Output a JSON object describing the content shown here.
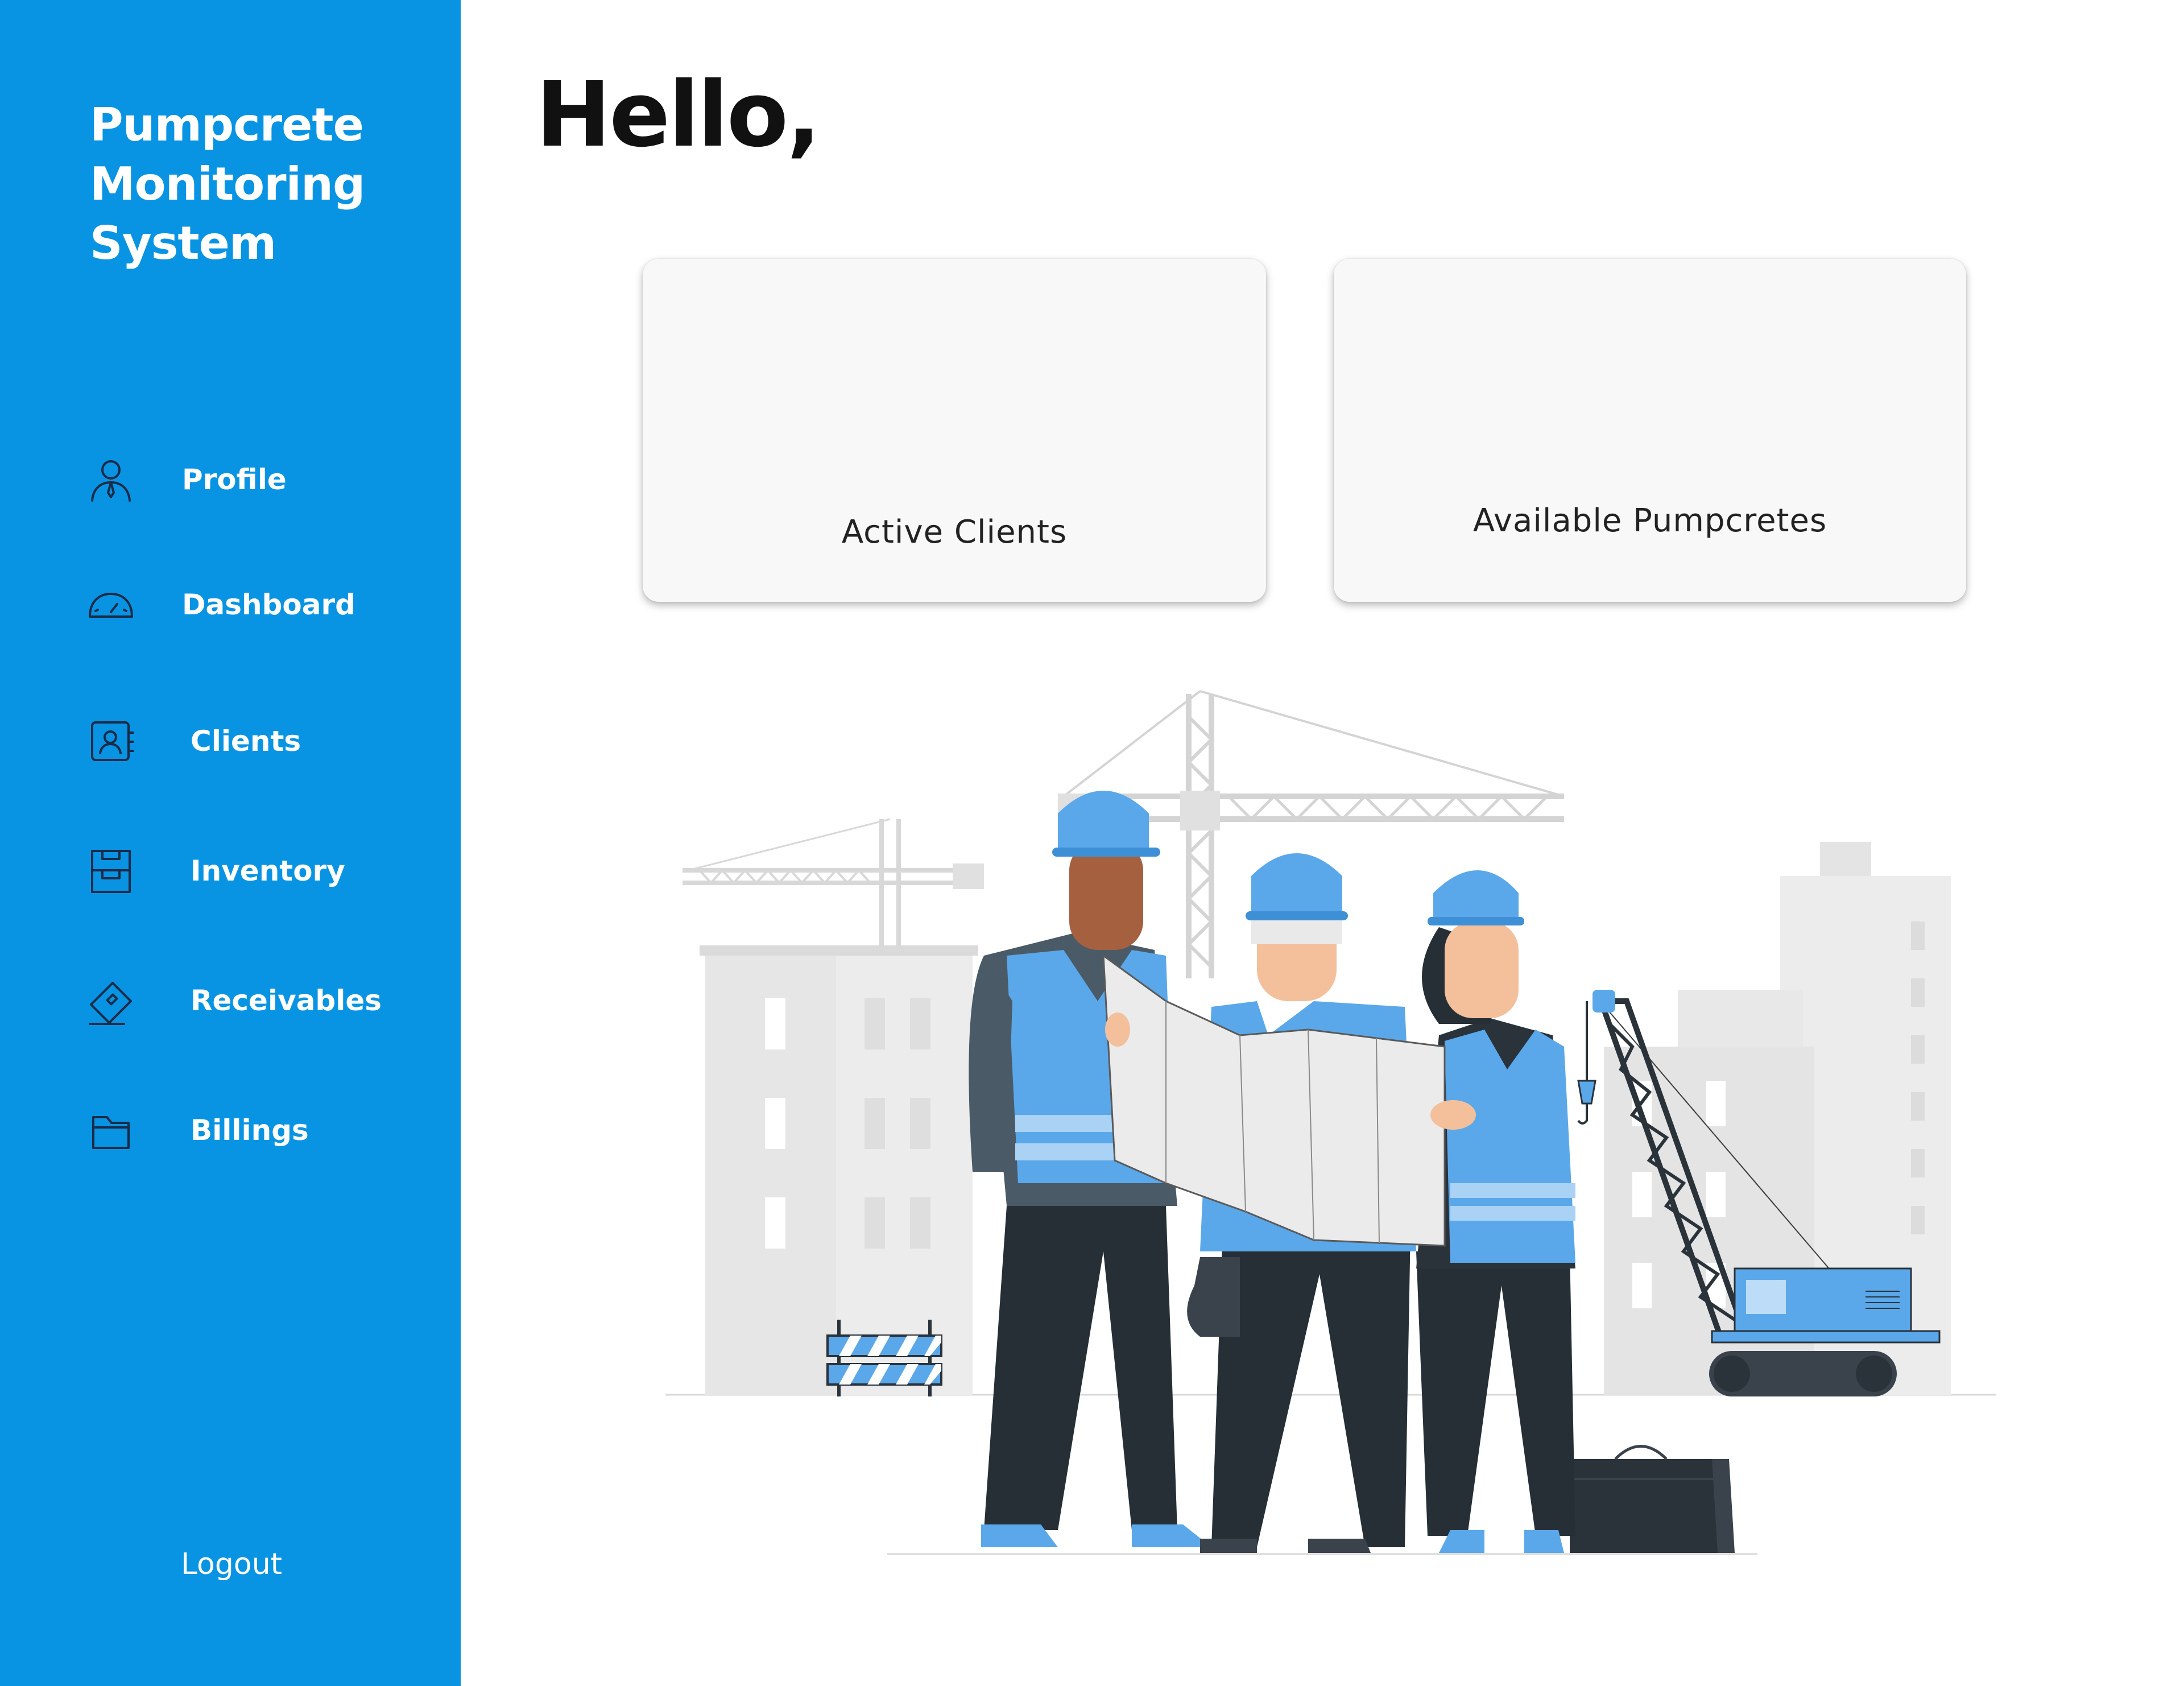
{
  "app": {
    "title": "Pumpcrete\nMonitoring\nSystem"
  },
  "sidebar": {
    "background": "#0994e3",
    "items": [
      {
        "label": "Profile",
        "icon": "user-icon"
      },
      {
        "label": "Dashboard",
        "icon": "gauge-icon"
      },
      {
        "label": "Clients",
        "icon": "contact-card-icon"
      },
      {
        "label": "Inventory",
        "icon": "archive-box-icon"
      },
      {
        "label": "Receivables",
        "icon": "ticket-icon"
      },
      {
        "label": "Billings",
        "icon": "folder-icon"
      }
    ],
    "logout_label": "Logout"
  },
  "main": {
    "greeting": "Hello,",
    "cards": [
      {
        "label": "Active Clients"
      },
      {
        "label": "Available Pumpcretes"
      }
    ],
    "illustration": "construction-workers-reviewing-blueprint"
  }
}
